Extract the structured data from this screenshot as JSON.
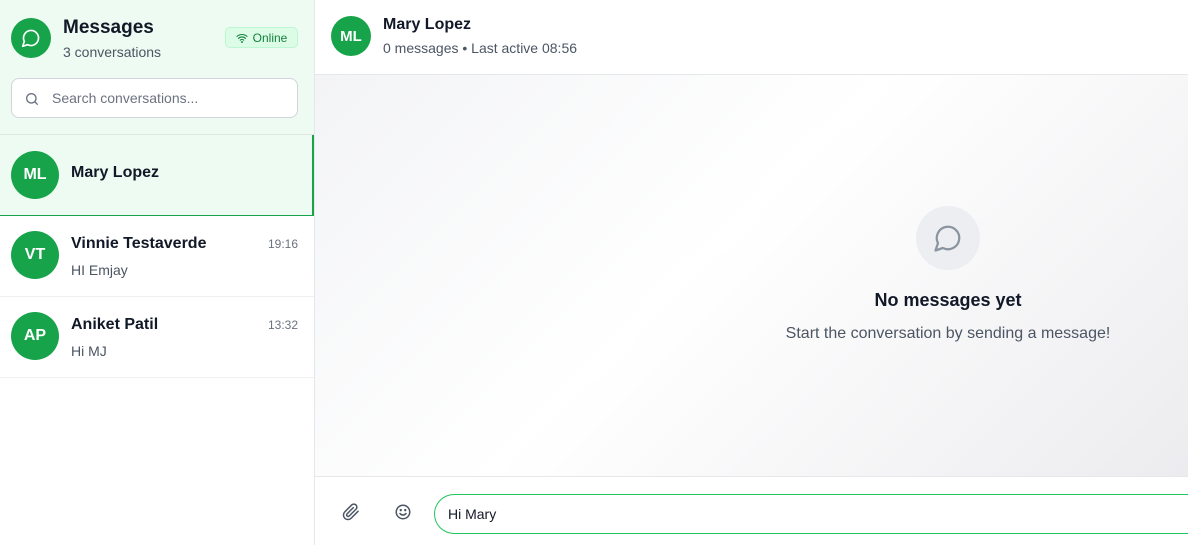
{
  "sidebar": {
    "title": "Messages",
    "subtitle": "3 conversations",
    "status_badge": "Online",
    "search": {
      "placeholder": "Search conversations...",
      "value": ""
    },
    "conversations": [
      {
        "initials": "ML",
        "name": "Mary Lopez",
        "time": "",
        "preview": "",
        "active": true
      },
      {
        "initials": "VT",
        "name": "Vinnie Testaverde",
        "time": "19:16",
        "preview": "HI Emjay",
        "active": false
      },
      {
        "initials": "AP",
        "name": "Aniket Patil",
        "time": "13:32",
        "preview": "Hi MJ",
        "active": false
      }
    ]
  },
  "chat": {
    "header": {
      "initials": "ML",
      "name": "Mary Lopez",
      "meta": "0 messages • Last active 08:56"
    },
    "empty_state": {
      "icon": "chat-bubble-icon",
      "title": "No messages yet",
      "subtitle": "Start the conversation by sending a message!"
    },
    "composer": {
      "attach_icon": "paperclip-icon",
      "emoji_icon": "smiley-icon",
      "value": "Hi Mary"
    }
  },
  "colors": {
    "accent": "#16a34a",
    "accent_light": "#eefbf2",
    "badge_bg": "#dcfce7"
  }
}
